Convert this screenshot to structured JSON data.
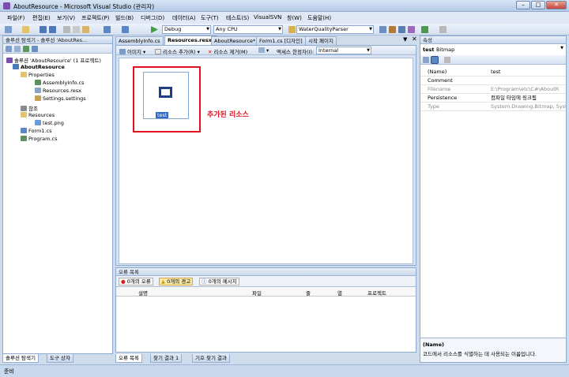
{
  "window": {
    "title": "AboutResource - Microsoft Visual Studio (관리자)"
  },
  "menu": [
    "파일(F)",
    "편집(E)",
    "보기(V)",
    "프로젝트(P)",
    "빌드(B)",
    "디버그(D)",
    "데이터(A)",
    "도구(T)",
    "테스트(S)",
    "VisualSVN",
    "창(W)",
    "도움말(H)"
  ],
  "toolbar": {
    "config": "Debug",
    "platform": "Any CPU",
    "startup": "WaterQualityParser"
  },
  "solution_explorer": {
    "header": "솔루션 탐색기 - 솔루션 'AboutRes...",
    "items": [
      "솔루션 'AboutResource' (1 프로젝트)",
      "AboutResource",
      "Properties",
      "AssemblyInfo.cs",
      "Resources.resx",
      "Settings.settings",
      "참조",
      "Resources",
      "test.png",
      "Form1.cs",
      "Program.cs"
    ],
    "tabs": [
      "솔루션 탐색기",
      "도구 상자"
    ]
  },
  "doc_tabs": [
    "AssemblyInfo.cs",
    "Resources.resx*",
    "AboutResource*",
    "Form1.cs [디자인]",
    "시작 페이지"
  ],
  "resource_toolbar": {
    "images": "이미지",
    "add": "리소스 추가(R)",
    "remove": "리소스 제거(M)",
    "access_label": "액세스 한정자(I):",
    "access_value": "Internal"
  },
  "resource_item": {
    "name": "test"
  },
  "annotation": "추가된 리소스",
  "error_list": {
    "header": "오류 목록",
    "buttons": [
      "0개의 오류",
      "0개의 경고",
      "0개의 메시지"
    ],
    "columns": [
      "설명",
      "파일",
      "줄",
      "열",
      "프로젝트"
    ],
    "tabs": [
      "오류 목록",
      "찾기 결과 1",
      "기호 찾기 결과"
    ]
  },
  "properties": {
    "header": "속성",
    "object": "test",
    "object_type": "Bitmap",
    "rows": [
      {
        "key": "(Name)",
        "value": "test",
        "dim": false
      },
      {
        "key": "Comment",
        "value": "",
        "dim": false
      },
      {
        "key": "Filename",
        "value": "E:\\Program\\etc\\C#\\AboutR",
        "dim": true
      },
      {
        "key": "Persistence",
        "value": "컴파일 타임에 링크됨",
        "dim": false
      },
      {
        "key": "Type",
        "value": "System.Drawing.Bitmap, System",
        "dim": true
      }
    ],
    "desc_title": "(Name)",
    "desc_text": "코드에서 리소스를 식별하는 데 사용되는 이름입니다."
  },
  "status": "준비",
  "colors": {
    "accent": "#316ac5",
    "annotation": "#e0101e"
  }
}
